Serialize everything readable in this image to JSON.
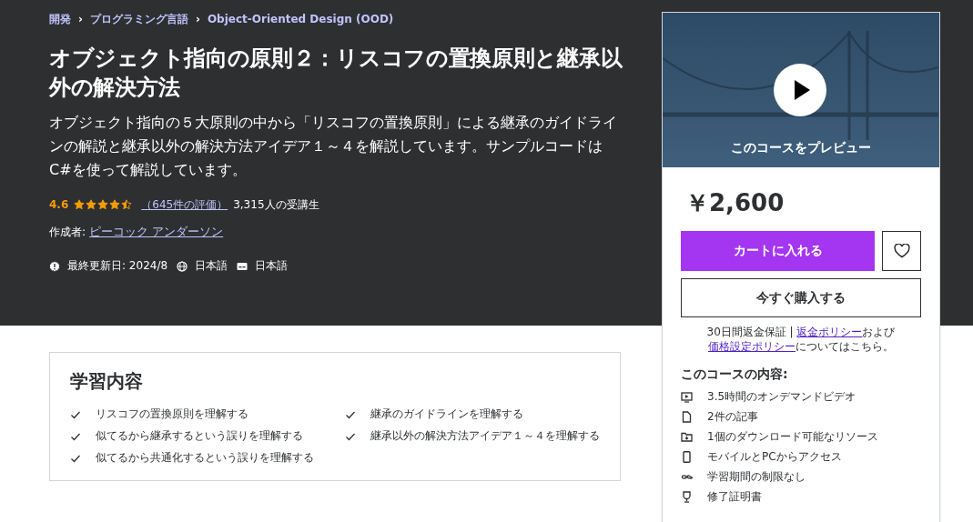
{
  "breadcrumbs": [
    {
      "label": "開発"
    },
    {
      "label": "プログラミング言語"
    },
    {
      "label": "Object-Oriented Design (OOD)"
    }
  ],
  "separator": "›",
  "title": "オブジェクト指向の原則２：リスコフの置換原則と継承以外の解決方法",
  "description": "オブジェクト指向の５大原則の中から「リスコフの置換原則」による継承のガイドラインの解説と継承以外の解決方法アイデア１～４を解説しています。サンプルコードはC#を使って解説しています。",
  "rating": {
    "score": "4.6",
    "stars": 4.5,
    "reviews": "（645件の評価）",
    "students": "3,315人の受講生"
  },
  "author": {
    "label": "作成者:",
    "name": "ピーコック アンダーソン"
  },
  "meta": [
    {
      "kind": "updated",
      "text": "最終更新日: 2024/8"
    },
    {
      "kind": "language",
      "text": "日本語"
    },
    {
      "kind": "captions",
      "text": "日本語"
    }
  ],
  "learn": {
    "heading": "学習内容",
    "items": [
      "リスコフの置換原則を理解する",
      "継承のガイドラインを理解する",
      "似てるから継承するという誤りを理解する",
      "継承以外の解決方法アイデア１～４を理解する",
      "似てるから共通化するという誤りを理解する"
    ]
  },
  "sidebar": {
    "preview_label": "このコースをプレビュー",
    "price": "￥2,600",
    "cart_button": "カートに入れる",
    "buy_button": "今すぐ購入する",
    "wishlisted": false,
    "guarantee": [
      {
        "kind": "text",
        "text": "30日間返金保証 | "
      },
      {
        "kind": "link",
        "text": "返金ポリシー"
      },
      {
        "kind": "text",
        "text": "および"
      },
      {
        "kind": "link",
        "text": "価格設定ポリシー"
      },
      {
        "kind": "text",
        "text": "についてはこちら。"
      }
    ],
    "includes_heading": "このコースの内容:",
    "includes": [
      {
        "kind": "video",
        "text": "3.5時間のオンデマンドビデオ"
      },
      {
        "kind": "article",
        "text": "2件の記事"
      },
      {
        "kind": "download",
        "text": "1個のダウンロード可能なリソース"
      },
      {
        "kind": "mobile",
        "text": "モバイルとPCからアクセス"
      },
      {
        "kind": "infinity",
        "text": "学習期間の制限なし"
      },
      {
        "kind": "certificate",
        "text": "修了証明書"
      }
    ]
  }
}
